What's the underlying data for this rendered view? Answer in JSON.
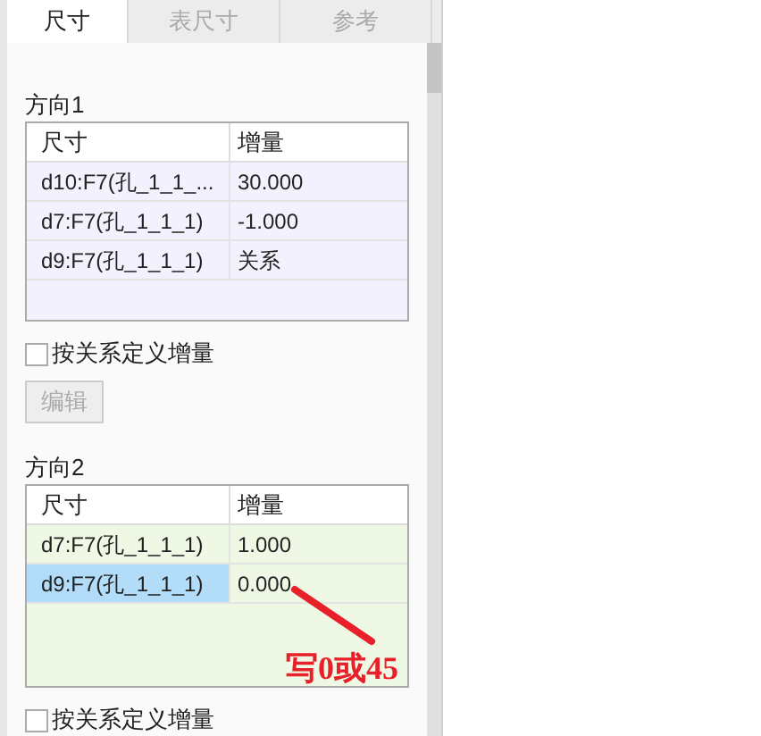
{
  "tabs": [
    {
      "label": "尺寸",
      "selected": true
    },
    {
      "label": "表尺寸",
      "selected": false
    },
    {
      "label": "参考",
      "selected": false
    }
  ],
  "sections": [
    {
      "title": "方向1",
      "color": "#f3f1fd",
      "columns": [
        "尺寸",
        "增量"
      ],
      "rows": [
        {
          "dimension": "d10:F7(孔_1_1_...",
          "increment": "30.000",
          "selected": false
        },
        {
          "dimension": "d7:F7(孔_1_1_1)",
          "increment": "-1.000",
          "selected": false
        },
        {
          "dimension": "d9:F7(孔_1_1_1)",
          "increment": "关系",
          "selected": false
        }
      ],
      "checkbox": {
        "label": "按关系定义增量",
        "checked": false
      },
      "button": {
        "label": "编辑",
        "disabled": true
      }
    },
    {
      "title": "方向2",
      "color": "#eef8e4",
      "columns": [
        "尺寸",
        "增量"
      ],
      "rows": [
        {
          "dimension": "d7:F7(孔_1_1_1)",
          "increment": "1.000",
          "selected": false
        },
        {
          "dimension": "d9:F7(孔_1_1_1)",
          "increment": "0.000",
          "selected": true
        }
      ],
      "checkbox": {
        "label": "按关系定义增量",
        "checked": false
      }
    }
  ],
  "annotation": "写0或45"
}
